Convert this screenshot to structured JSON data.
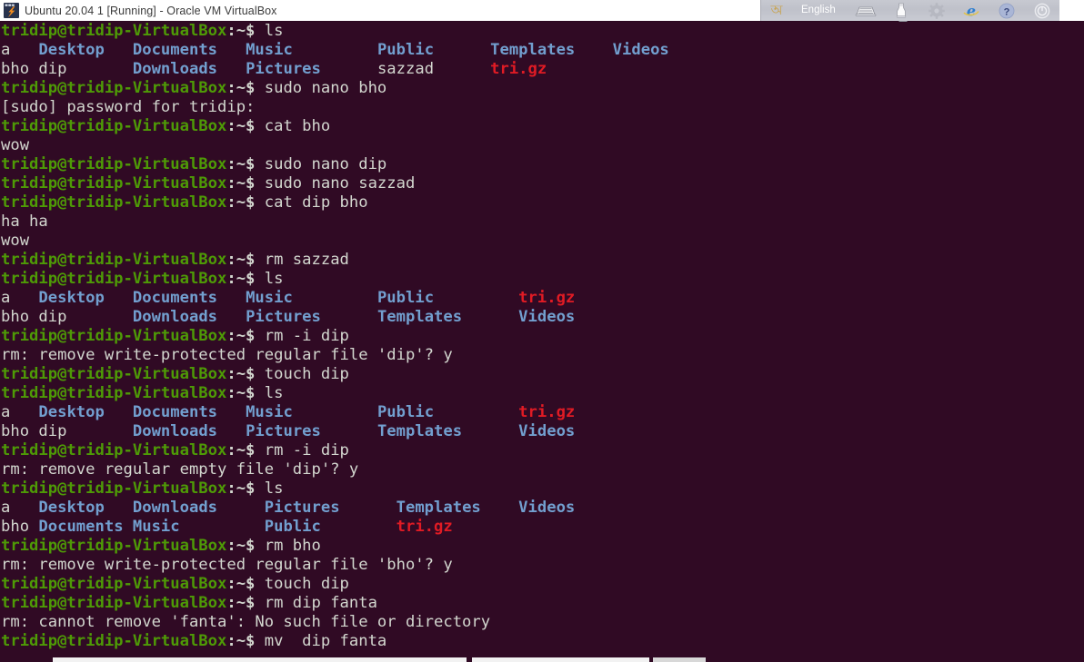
{
  "window": {
    "title": "Ubuntu 20.04 1 [Running] - Oracle VM VirtualBox",
    "logo_icon": "virtualbox-vm-icon",
    "titlebar_bg": "#ffffff",
    "terminal_bg": "#300a24"
  },
  "tray": {
    "language_glyph": "অ",
    "language_label": "English",
    "items": [
      {
        "name": "language-indicator-icon",
        "glyph": "অ"
      },
      {
        "name": "keyboard-icon"
      },
      {
        "name": "printer-icon"
      },
      {
        "name": "settings-gear-icon"
      },
      {
        "name": "internet-explorer-icon"
      },
      {
        "name": "help-icon"
      },
      {
        "name": "power-icon"
      }
    ]
  },
  "colors": {
    "prompt_green": "#4e9a06",
    "text_white": "#d3d7cf",
    "directory_blue": "#729fcf",
    "archive_red": "#e01b24",
    "background": "#300a24"
  },
  "terminal": {
    "user": "tridip",
    "host": "tridip-VirtualBox",
    "prompt_path": ":~$",
    "lines": [
      {
        "type": "cmd",
        "command": " ls"
      },
      {
        "type": "ls",
        "cells": [
          {
            "t": "a",
            "c": "plain",
            "w": 4
          },
          {
            "t": "Desktop",
            "c": "dir",
            "w": 10
          },
          {
            "t": "Documents",
            "c": "dir",
            "w": 12
          },
          {
            "t": "Music",
            "c": "dir",
            "w": 14
          },
          {
            "t": "Public",
            "c": "dir",
            "w": 12
          },
          {
            "t": "Templates",
            "c": "dir",
            "w": 13
          },
          {
            "t": "Videos",
            "c": "dir",
            "w": 0
          }
        ]
      },
      {
        "type": "ls",
        "cells": [
          {
            "t": "bho",
            "c": "plain",
            "w": 4
          },
          {
            "t": "dip",
            "c": "plain",
            "w": 10
          },
          {
            "t": "Downloads",
            "c": "dir",
            "w": 12
          },
          {
            "t": "Pictures",
            "c": "dir",
            "w": 14
          },
          {
            "t": "sazzad",
            "c": "plain",
            "w": 12
          },
          {
            "t": "tri.gz",
            "c": "arch",
            "w": 0
          }
        ]
      },
      {
        "type": "cmd",
        "command": " sudo nano bho"
      },
      {
        "type": "out",
        "text": "[sudo] password for tridip:"
      },
      {
        "type": "cmd",
        "command": " cat bho"
      },
      {
        "type": "out",
        "text": "wow"
      },
      {
        "type": "cmd",
        "command": " sudo nano dip"
      },
      {
        "type": "cmd",
        "command": " sudo nano sazzad"
      },
      {
        "type": "cmd",
        "command": " cat dip bho"
      },
      {
        "type": "out",
        "text": "ha ha"
      },
      {
        "type": "out",
        "text": "wow"
      },
      {
        "type": "cmd",
        "command": " rm sazzad"
      },
      {
        "type": "cmd",
        "command": " ls"
      },
      {
        "type": "ls",
        "cells": [
          {
            "t": "a",
            "c": "plain",
            "w": 4
          },
          {
            "t": "Desktop",
            "c": "dir",
            "w": 10
          },
          {
            "t": "Documents",
            "c": "dir",
            "w": 12
          },
          {
            "t": "Music",
            "c": "dir",
            "w": 14
          },
          {
            "t": "Public",
            "c": "dir",
            "w": 15
          },
          {
            "t": "tri.gz",
            "c": "arch",
            "w": 0
          }
        ]
      },
      {
        "type": "ls",
        "cells": [
          {
            "t": "bho",
            "c": "plain",
            "w": 4
          },
          {
            "t": "dip",
            "c": "plain",
            "w": 10
          },
          {
            "t": "Downloads",
            "c": "dir",
            "w": 12
          },
          {
            "t": "Pictures",
            "c": "dir",
            "w": 14
          },
          {
            "t": "Templates",
            "c": "dir",
            "w": 15
          },
          {
            "t": "Videos",
            "c": "dir",
            "w": 0
          }
        ]
      },
      {
        "type": "cmd",
        "command": " rm -i dip"
      },
      {
        "type": "out",
        "text": "rm: remove write-protected regular file 'dip'? y"
      },
      {
        "type": "cmd",
        "command": " touch dip"
      },
      {
        "type": "cmd",
        "command": " ls"
      },
      {
        "type": "ls",
        "cells": [
          {
            "t": "a",
            "c": "plain",
            "w": 4
          },
          {
            "t": "Desktop",
            "c": "dir",
            "w": 10
          },
          {
            "t": "Documents",
            "c": "dir",
            "w": 12
          },
          {
            "t": "Music",
            "c": "dir",
            "w": 14
          },
          {
            "t": "Public",
            "c": "dir",
            "w": 15
          },
          {
            "t": "tri.gz",
            "c": "arch",
            "w": 0
          }
        ]
      },
      {
        "type": "ls",
        "cells": [
          {
            "t": "bho",
            "c": "plain",
            "w": 4
          },
          {
            "t": "dip",
            "c": "plain",
            "w": 10
          },
          {
            "t": "Downloads",
            "c": "dir",
            "w": 12
          },
          {
            "t": "Pictures",
            "c": "dir",
            "w": 14
          },
          {
            "t": "Templates",
            "c": "dir",
            "w": 15
          },
          {
            "t": "Videos",
            "c": "dir",
            "w": 0
          }
        ]
      },
      {
        "type": "cmd",
        "command": " rm -i dip"
      },
      {
        "type": "out",
        "text": "rm: remove regular empty file 'dip'? y"
      },
      {
        "type": "cmd",
        "command": " ls"
      },
      {
        "type": "ls",
        "cells": [
          {
            "t": "a",
            "c": "plain",
            "w": 4
          },
          {
            "t": "Desktop",
            "c": "dir",
            "w": 10
          },
          {
            "t": "Downloads",
            "c": "dir",
            "w": 14
          },
          {
            "t": "Pictures",
            "c": "dir",
            "w": 14
          },
          {
            "t": "Templates",
            "c": "dir",
            "w": 13
          },
          {
            "t": "Videos",
            "c": "dir",
            "w": 0
          }
        ]
      },
      {
        "type": "ls",
        "cells": [
          {
            "t": "bho",
            "c": "plain",
            "w": 4
          },
          {
            "t": "Documents",
            "c": "dir",
            "w": 10
          },
          {
            "t": "Music",
            "c": "dir",
            "w": 14
          },
          {
            "t": "Public",
            "c": "dir",
            "w": 14
          },
          {
            "t": "tri.gz",
            "c": "arch",
            "w": 0
          }
        ]
      },
      {
        "type": "cmd",
        "command": " rm bho"
      },
      {
        "type": "out",
        "text": "rm: remove write-protected regular file 'bho'? y"
      },
      {
        "type": "cmd",
        "command": " touch dip"
      },
      {
        "type": "cmd",
        "command": " rm dip fanta"
      },
      {
        "type": "out",
        "text": "rm: cannot remove 'fanta': No such file or directory"
      },
      {
        "type": "cmd",
        "command": " mv  dip fanta"
      }
    ]
  }
}
